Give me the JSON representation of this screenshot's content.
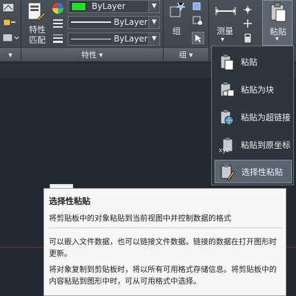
{
  "ribbon": {
    "match_properties_label_line1": "特性",
    "match_properties_label_line2": "匹配",
    "color_dropdown_value": "ByLayer",
    "linetype_dropdown_value": "ByLayer",
    "lineweight_dropdown_value": "ByLayer",
    "group_label": "组",
    "measure_label": "测量",
    "paste_label": "粘贴",
    "panel_properties": "特性 ▾",
    "panel_group": "组 ▾",
    "panel_arrow_left": "▾",
    "panel_arrow_right": "▾",
    "panel_arrow_far_right": "▾",
    "color_swatch": "#22dd22"
  },
  "paste_menu": {
    "items": [
      {
        "label": "粘贴",
        "icon": "paste-icon"
      },
      {
        "label": "粘贴为块",
        "icon": "paste-as-block-icon"
      },
      {
        "label": "粘贴为超链接",
        "icon": "paste-as-hyperlink-icon"
      },
      {
        "label": "粘贴到原坐标",
        "icon": "paste-to-original-coordinates-icon"
      },
      {
        "label": "选择性粘贴",
        "icon": "paste-special-icon"
      }
    ],
    "selected_index": 4
  },
  "tooltip": {
    "title": "选择性粘贴",
    "summary": "将剪贴板中的对象粘贴到当前视图中并控制数据的格式",
    "paragraph1": "可以嵌入文件数据，也可以链接文件数据。链接的数据在打开图形时更新。",
    "paragraph2": "将对象复制到剪贴板时，将以所有可用格式存储信息。将剪贴板中的内容粘贴到图形中时，可从可用格式中选择。"
  }
}
